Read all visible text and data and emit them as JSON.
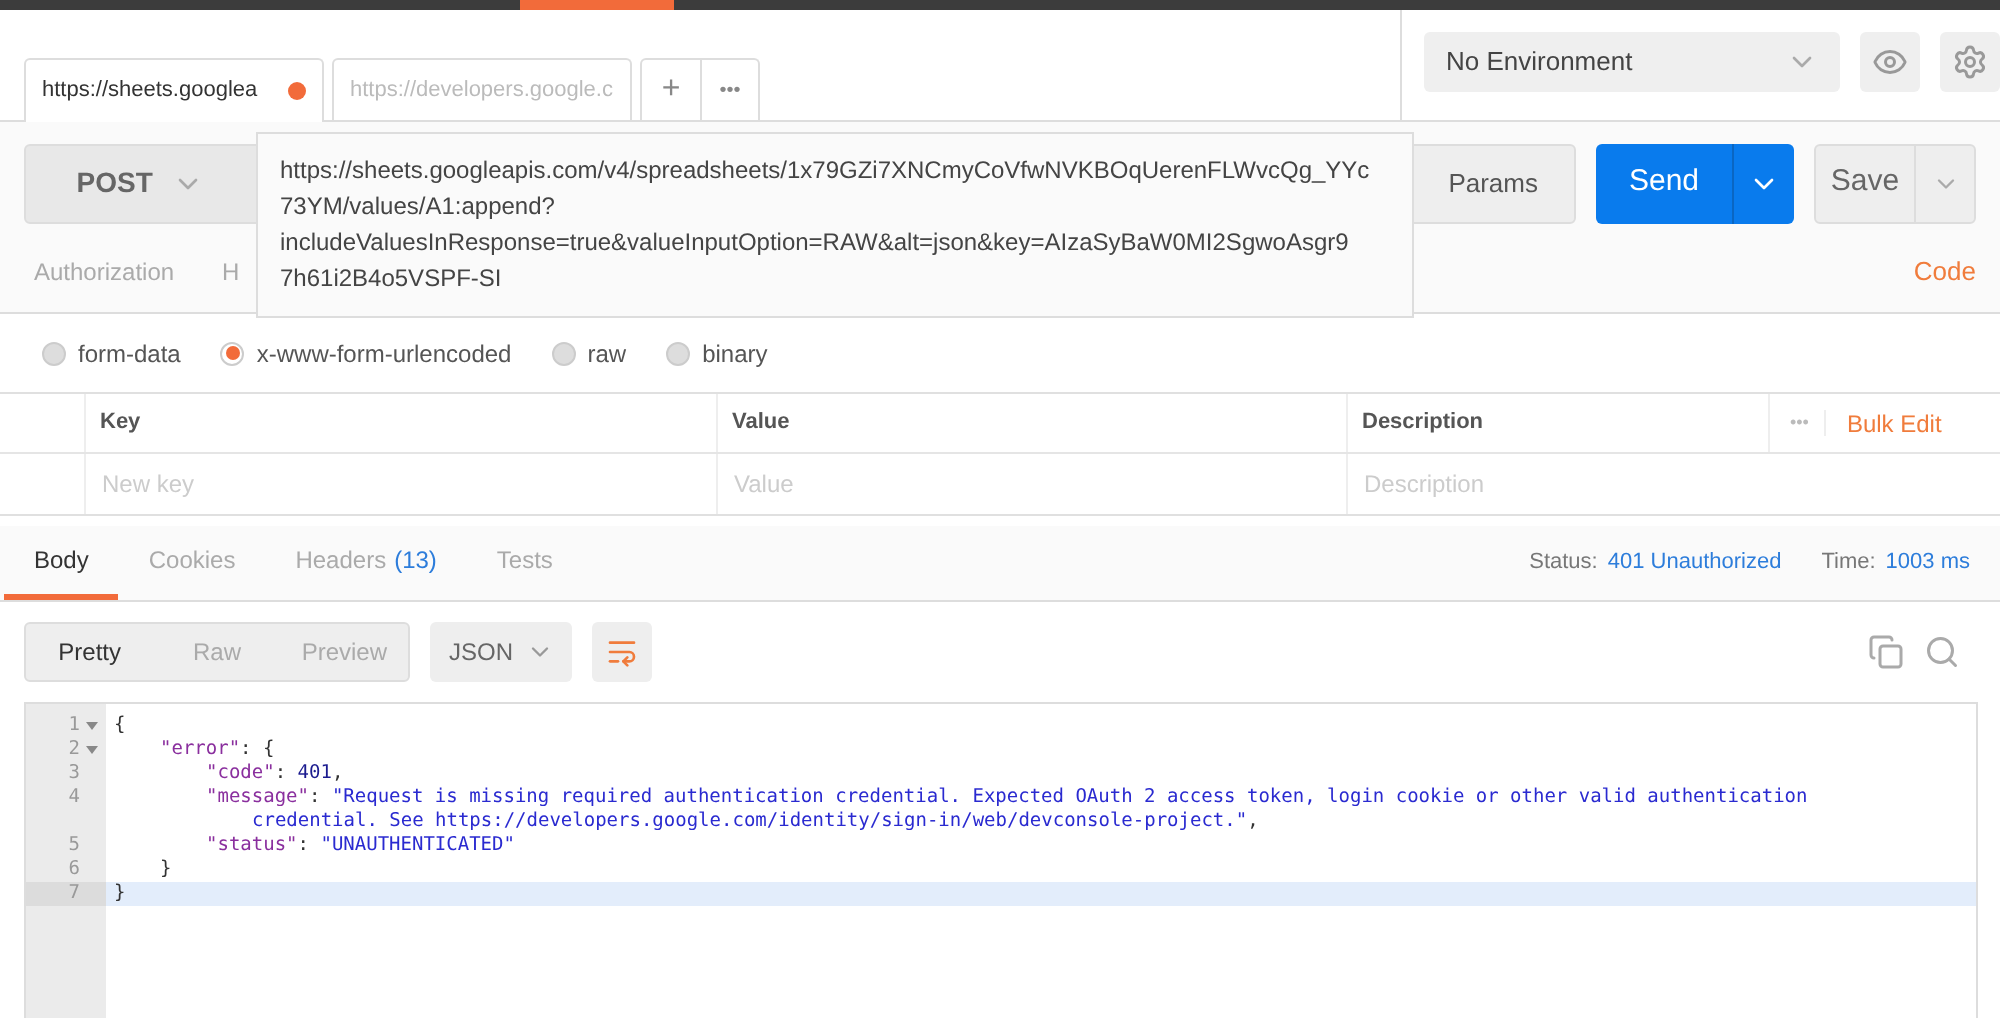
{
  "tabs": [
    {
      "label": "https://sheets.googlea",
      "selected": true,
      "unsaved": true
    },
    {
      "label": "https://developers.google.c",
      "selected": false,
      "unsaved": false
    }
  ],
  "tab_actions": {
    "add": "+",
    "more": "•••"
  },
  "environment": {
    "value": "No Environment"
  },
  "request": {
    "method": "POST",
    "url_lines": [
      "https://sheets.googleapis.com/v4/spreadsheets/1x79GZi7XNCmyCoVfwNVKBOqUerenFLWvcQg_YYc",
      "73YM/values/A1:append?",
      "includeValuesInResponse=true&valueInputOption=RAW&alt=json&key=AIzaSyBaW0MI2SgwoAsgr9",
      "7h61i2B4o5VSPF-SI"
    ],
    "params": "Params",
    "send": "Send",
    "save": "Save"
  },
  "request_tabs": [
    {
      "label": "Authorization",
      "selected": false
    },
    {
      "label": "H",
      "selected": false
    }
  ],
  "code_link": "Code",
  "body_modes": [
    {
      "label": "form-data",
      "selected": false
    },
    {
      "label": "x-www-form-urlencoded",
      "selected": true
    },
    {
      "label": "raw",
      "selected": false
    },
    {
      "label": "binary",
      "selected": false
    }
  ],
  "params_table": {
    "columns": [
      "Key",
      "Value",
      "Description"
    ],
    "more": "•••",
    "bulk_edit": "Bulk Edit",
    "new_row": {
      "key_placeholder": "New key",
      "value_placeholder": "Value",
      "description_placeholder": "Description"
    }
  },
  "response_tabs": [
    {
      "label": "Body",
      "selected": true
    },
    {
      "label": "Cookies",
      "selected": false
    },
    {
      "label": "Headers",
      "count": "(13)",
      "selected": false
    },
    {
      "label": "Tests",
      "selected": false
    }
  ],
  "status": {
    "label": "Status:",
    "value": "401 Unauthorized"
  },
  "time": {
    "label": "Time:",
    "value": "1003 ms"
  },
  "view_modes": [
    {
      "label": "Pretty",
      "selected": true
    },
    {
      "label": "Raw",
      "selected": false
    },
    {
      "label": "Preview",
      "selected": false
    }
  ],
  "format": "JSON",
  "code_lines": [
    {
      "number": "1",
      "fold": true,
      "current": false,
      "segments": [
        {
          "kind": "punct",
          "text": "{"
        }
      ]
    },
    {
      "number": "2",
      "fold": true,
      "current": false,
      "segments": [
        {
          "kind": "key",
          "text": "\"error\""
        },
        {
          "kind": "punct",
          "text": ": {"
        }
      ]
    },
    {
      "number": "3",
      "fold": false,
      "current": false,
      "segments": [
        {
          "kind": "key",
          "text": "\"code\""
        },
        {
          "kind": "punct",
          "text": ": "
        },
        {
          "kind": "number",
          "text": "401"
        },
        {
          "kind": "punct",
          "text": ","
        }
      ]
    },
    {
      "number": "4",
      "fold": false,
      "current": false,
      "segments": [
        {
          "kind": "key",
          "text": "\"message\""
        },
        {
          "kind": "punct",
          "text": ": "
        },
        {
          "kind": "string",
          "text": "\"Request is missing required authentication credential. Expected OAuth 2 access token, login cookie or other valid authentication"
        }
      ]
    },
    {
      "continuation": true,
      "fold": false,
      "current": false,
      "segments": [
        {
          "kind": "string",
          "text": "credential. See https://developers.google.com/identity/sign-in/web/devconsole-project.\""
        },
        {
          "kind": "punct",
          "text": ","
        }
      ]
    },
    {
      "number": "5",
      "fold": false,
      "current": false,
      "segments": [
        {
          "kind": "key",
          "text": "\"status\""
        },
        {
          "kind": "punct",
          "text": ": "
        },
        {
          "kind": "string",
          "text": "\"UNAUTHENTICATED\""
        }
      ]
    },
    {
      "number": "6",
      "fold": false,
      "current": false,
      "segments": [
        {
          "kind": "punct",
          "text": "}"
        }
      ]
    },
    {
      "number": "7",
      "fold": false,
      "current": true,
      "segments": [
        {
          "kind": "punct",
          "text": "}"
        }
      ]
    }
  ]
}
